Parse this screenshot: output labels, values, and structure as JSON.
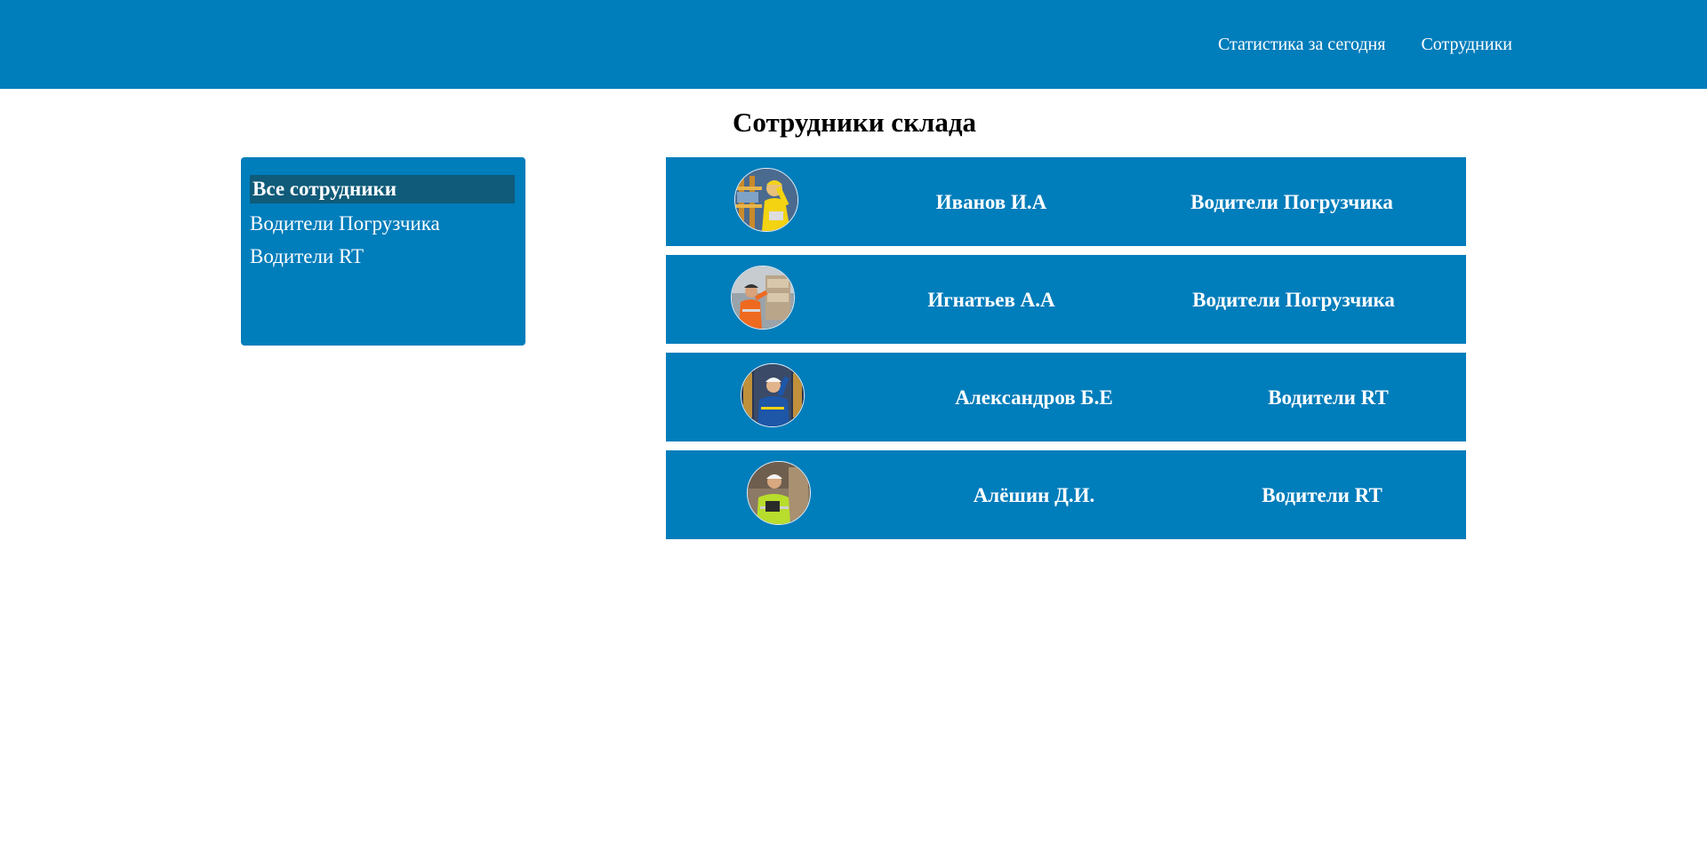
{
  "nav": {
    "links": [
      {
        "label": "Статистика за сегодня"
      },
      {
        "label": "Сотрудники"
      }
    ]
  },
  "page": {
    "title": "Сотрудники склада"
  },
  "filters": {
    "items": [
      {
        "label": "Все сотрудники",
        "active": true
      },
      {
        "label": "Водители Погрузчика",
        "active": false
      },
      {
        "label": "Водители RT",
        "active": false
      }
    ]
  },
  "employees": [
    {
      "name": "Иванов И.А",
      "group": "Водители Погрузчика",
      "avatar": "worker-photo-yellow-vest"
    },
    {
      "name": "Игнатьев А.А",
      "group": "Водители Погрузчика",
      "avatar": "worker-photo-orange-vest"
    },
    {
      "name": "Александров Б.Е",
      "group": "Водители RT",
      "avatar": "worker-photo-blue-uniform"
    },
    {
      "name": "Алёшин Д.И.",
      "group": "Водители RT",
      "avatar": "worker-photo-tablet"
    }
  ],
  "colors": {
    "primary": "#007dbb",
    "active_filter": "#0f5b79",
    "text_light": "#ffffff"
  }
}
